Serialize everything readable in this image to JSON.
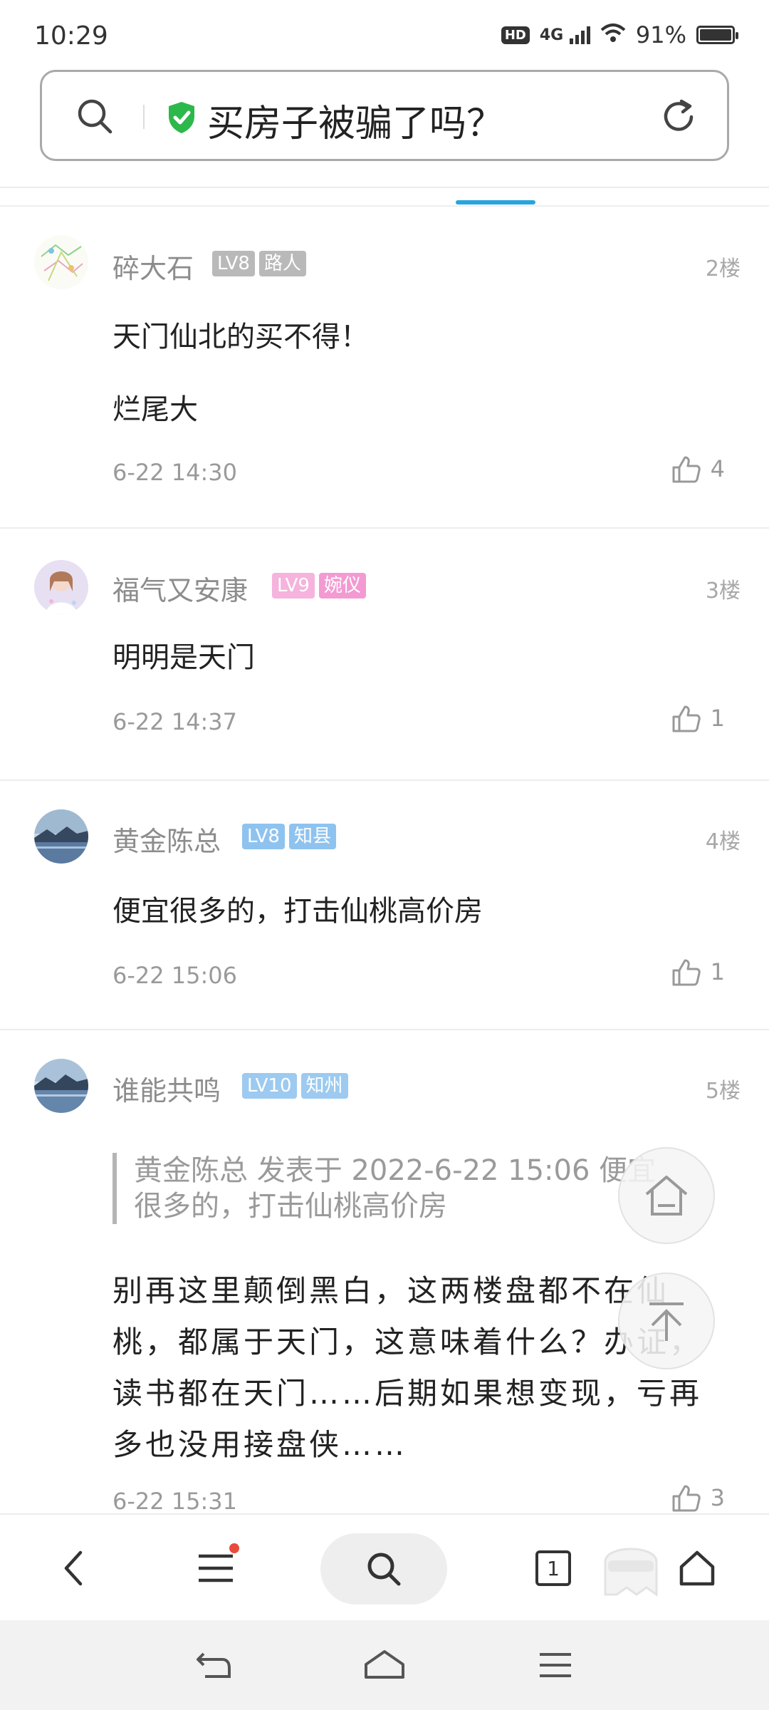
{
  "status_bar": {
    "time": "10:29",
    "hd": "HD",
    "network": "4G",
    "battery_percent_text": "91%",
    "battery_level": 0.91
  },
  "search": {
    "query": "买房子被骗了吗？",
    "shield_color": "#2db84c"
  },
  "posts": [
    {
      "username": "碎大石",
      "level": "LV8",
      "title": "路人",
      "level_color": "#b9b9b9",
      "title_color": "#b9b9b9",
      "floor": "2楼",
      "lines": [
        "天门仙北的买不得！",
        "烂尾大"
      ],
      "time": "6-22 14:30",
      "likes": "4"
    },
    {
      "username": "福气又安康",
      "level": "LV9",
      "title": "婉仪",
      "level_color": "#f5b3dd",
      "title_color": "#f39ad2",
      "floor": "3楼",
      "lines": [
        "明明是天门"
      ],
      "time": "6-22 14:37",
      "likes": "1"
    },
    {
      "username": "黄金陈总",
      "level": "LV8",
      "title": "知县",
      "level_color": "#8fc3ef",
      "title_color": "#8fc3ef",
      "floor": "4楼",
      "lines": [
        "便宜很多的，打击仙桃高价房"
      ],
      "time": "6-22 15:06",
      "likes": "1"
    },
    {
      "username": "谁能共鸣",
      "level": "LV10",
      "title": "知州",
      "level_color": "#9ccaf0",
      "title_color": "#9ccaf0",
      "floor": "5楼",
      "quote": [
        "黄金陈总 发表于 2022-6-22 15:06 便宜",
        "很多的，打击仙桃高价房"
      ],
      "content": "别再这里颠倒黑白，这两楼盘都不在仙桃，都属于天门，这意味着什么？办证，读书都在天门……后期如果想变现，亏再多也没用接盘侠……",
      "time": "6-22 15:31",
      "likes": "3"
    }
  ],
  "bottom_nav": {
    "tab_count": "1"
  },
  "colors": {
    "accent": "#29a4de",
    "notification_dot": "#e74c3c"
  },
  "icons": {
    "search": "search-icon",
    "shield": "shield-check-icon",
    "refresh": "refresh-icon",
    "like": "thumbs-up-icon",
    "home_float": "home-icon",
    "back_top": "arrow-up-icon",
    "back": "chevron-left-icon",
    "menu": "menu-icon",
    "tabs": "tabs-icon",
    "home": "home-icon",
    "ghost": "ghost-mask-icon"
  }
}
